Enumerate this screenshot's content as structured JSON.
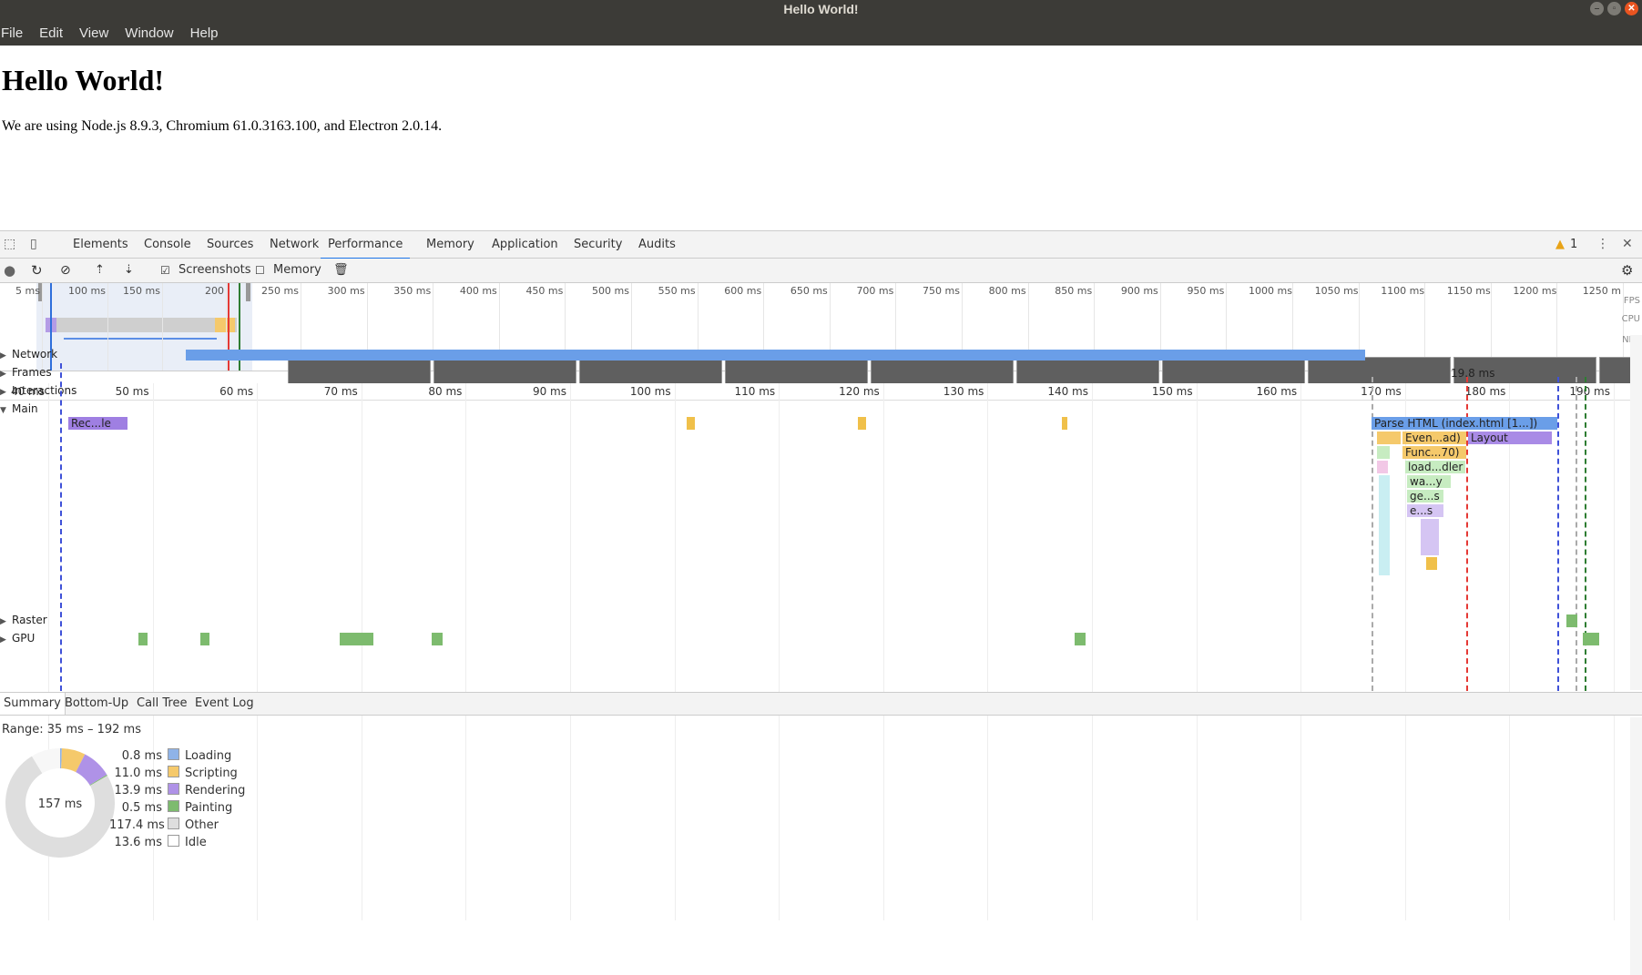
{
  "window": {
    "title": "Hello World!"
  },
  "menubar": {
    "items": [
      "File",
      "Edit",
      "View",
      "Window",
      "Help"
    ]
  },
  "page": {
    "heading": "Hello World!",
    "text": "We are using Node.js 8.9.3, Chromium 61.0.3163.100, and Electron 2.0.14."
  },
  "devtools": {
    "tabs": [
      "Elements",
      "Console",
      "Sources",
      "Network",
      "Performance",
      "Memory",
      "Application",
      "Security",
      "Audits"
    ],
    "active_tab": "Performance",
    "warning_count": "1",
    "toolbar": {
      "screenshots_label": "Screenshots",
      "screenshots_checked": true,
      "memory_label": "Memory",
      "memory_checked": false
    },
    "overview": {
      "tick_labels": [
        "5 ms",
        "100 ms",
        "150 ms",
        "200",
        "250 ms",
        "300 ms",
        "350 ms",
        "400 ms",
        "450 ms",
        "500 ms",
        "550 ms",
        "600 ms",
        "650 ms",
        "700 ms",
        "750 ms",
        "800 ms",
        "850 ms",
        "900 ms",
        "950 ms",
        "1000 ms",
        "1050 ms",
        "1100 ms",
        "1150 ms",
        "1200 ms",
        "1250 m"
      ],
      "side_labels": [
        "FPS",
        "CPU",
        "NET"
      ]
    },
    "ruler": {
      "labels": [
        "40 ms",
        "50 ms",
        "60 ms",
        "70 ms",
        "80 ms",
        "90 ms",
        "100 ms",
        "110 ms",
        "120 ms",
        "130 ms",
        "140 ms",
        "150 ms",
        "160 ms",
        "170 ms",
        "180 ms",
        "190 ms"
      ]
    },
    "tracks": {
      "network": "Network",
      "frames": "Frames",
      "interactions": "Interactions",
      "main": "Main",
      "raster": "Raster",
      "gpu": "GPU"
    },
    "frame_time": "19.8 ms",
    "flame": {
      "rec": "Rec...le",
      "parse_html": "Parse HTML (index.html [1...])",
      "event": "Even...ad)",
      "layout": "Layout",
      "func": "Func...70)",
      "load": "load...dler",
      "wa": "wa...y",
      "ge": "ge...s",
      "e": "e...s"
    },
    "bottom_tabs": [
      "Summary",
      "Bottom-Up",
      "Call Tree",
      "Event Log"
    ],
    "summary": {
      "range": "Range: 35 ms – 192 ms",
      "total": "157 ms",
      "items": [
        {
          "value": "0.8 ms",
          "label": "Loading",
          "color": "#8fb3e8",
          "ms": 0.8
        },
        {
          "value": "11.0 ms",
          "label": "Scripting",
          "color": "#f5c96b",
          "ms": 11.0
        },
        {
          "value": "13.9 ms",
          "label": "Rendering",
          "color": "#af92e7",
          "ms": 13.9
        },
        {
          "value": "0.5 ms",
          "label": "Painting",
          "color": "#7dbb6e",
          "ms": 0.5
        },
        {
          "value": "117.4 ms",
          "label": "Other",
          "color": "#dedede",
          "ms": 117.4
        },
        {
          "value": "13.6 ms",
          "label": "Idle",
          "color": "#ffffff",
          "ms": 13.6
        }
      ]
    }
  }
}
